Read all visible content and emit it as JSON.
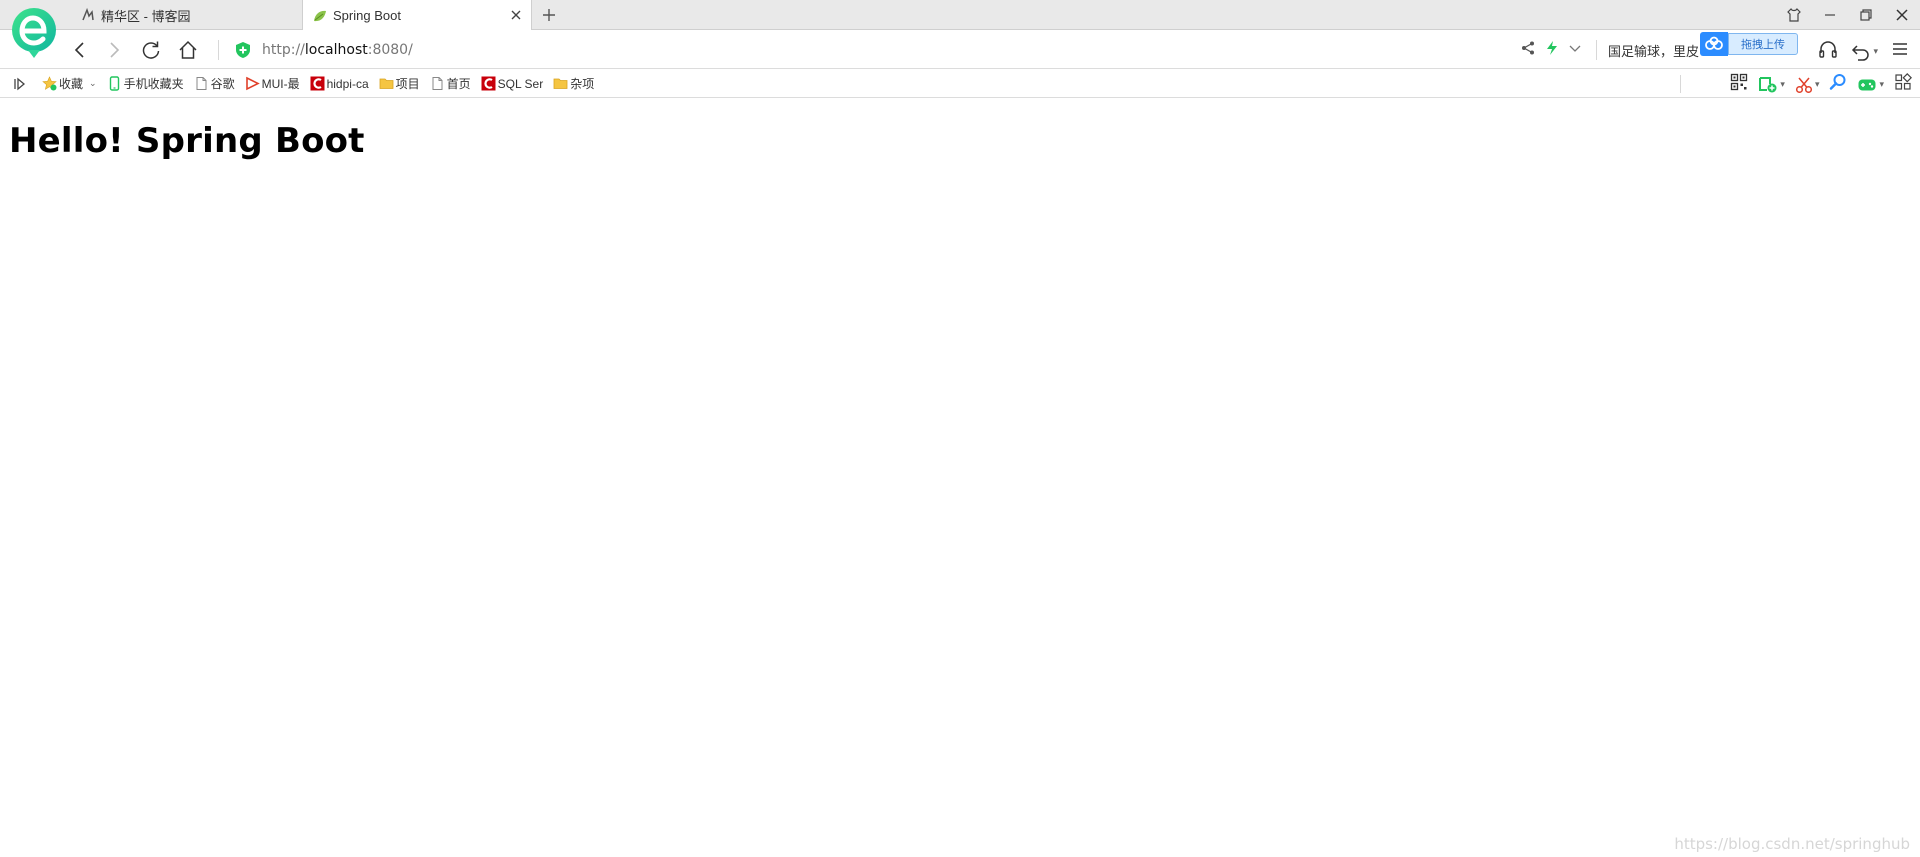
{
  "tabs": [
    {
      "title": "精华区 - 博客园",
      "active": false
    },
    {
      "title": "Spring Boot",
      "active": true
    }
  ],
  "address": {
    "scheme": "http://",
    "host": "localhost",
    "rest": ":8080/"
  },
  "news_ticker": "国足输球，里皮",
  "baidu": {
    "button_label": "拖拽上传"
  },
  "bookmarks": [
    {
      "label": "收藏",
      "icon": "star-icon"
    },
    {
      "label": "手机收藏夹",
      "icon": "phone-icon"
    },
    {
      "label": "谷歌",
      "icon": "page-icon"
    },
    {
      "label": "MUI-最",
      "icon": "mui-icon"
    },
    {
      "label": "hidpi-ca",
      "icon": "csdn-icon"
    },
    {
      "label": "项目",
      "icon": "folder-icon"
    },
    {
      "label": "首页",
      "icon": "page-icon"
    },
    {
      "label": "SQL Ser",
      "icon": "csdn-icon"
    },
    {
      "label": "杂项",
      "icon": "folder-icon"
    }
  ],
  "content": {
    "heading": "Hello! Spring Boot"
  },
  "watermark": "https://blog.csdn.net/springhub",
  "colors": {
    "accent_green": "#22c55e",
    "csdn_red": "#c8000b",
    "folder_yellow": "#f5c542",
    "baidu_blue": "#2b8cff"
  }
}
